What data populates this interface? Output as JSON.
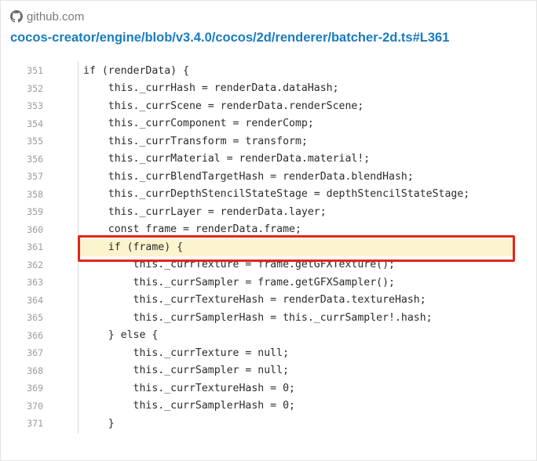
{
  "source": {
    "site": "github.com",
    "icon": "github-icon"
  },
  "link": {
    "text": "cocos-creator/engine/blob/v3.4.0/cocos/2d/renderer/batcher-2d.ts#L361"
  },
  "code": {
    "highlight_line": "361",
    "highlight_color": "#fcf4cf",
    "box_color": "#e0261d",
    "lines": [
      {
        "num": "351",
        "text": "if (renderData) {"
      },
      {
        "num": "352",
        "text": "    this._currHash = renderData.dataHash;"
      },
      {
        "num": "353",
        "text": "    this._currScene = renderData.renderScene;"
      },
      {
        "num": "354",
        "text": "    this._currComponent = renderComp;"
      },
      {
        "num": "355",
        "text": "    this._currTransform = transform;"
      },
      {
        "num": "356",
        "text": "    this._currMaterial = renderData.material!;"
      },
      {
        "num": "357",
        "text": "    this._currBlendTargetHash = renderData.blendHash;"
      },
      {
        "num": "358",
        "text": "    this._currDepthStencilStateStage = depthStencilStateStage;"
      },
      {
        "num": "359",
        "text": "    this._currLayer = renderData.layer;"
      },
      {
        "num": "360",
        "text": "    const frame = renderData.frame;"
      },
      {
        "num": "361",
        "text": "    if (frame) {"
      },
      {
        "num": "362",
        "text": "        this._currTexture = frame.getGFXTexture();"
      },
      {
        "num": "363",
        "text": "        this._currSampler = frame.getGFXSampler();"
      },
      {
        "num": "364",
        "text": "        this._currTextureHash = renderData.textureHash;"
      },
      {
        "num": "365",
        "text": "        this._currSamplerHash = this._currSampler!.hash;"
      },
      {
        "num": "366",
        "text": "    } else {"
      },
      {
        "num": "367",
        "text": "        this._currTexture = null;"
      },
      {
        "num": "368",
        "text": "        this._currSampler = null;"
      },
      {
        "num": "369",
        "text": "        this._currTextureHash = 0;"
      },
      {
        "num": "370",
        "text": "        this._currSamplerHash = 0;"
      },
      {
        "num": "371",
        "text": "    }"
      }
    ]
  }
}
